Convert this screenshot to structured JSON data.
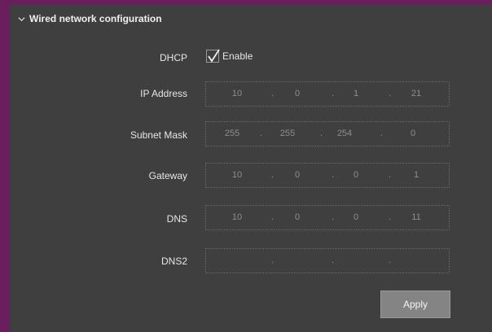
{
  "section": {
    "title": "Wired network configuration"
  },
  "dhcp": {
    "label": "DHCP",
    "checkbox_label": "Enable",
    "checked": true
  },
  "ip_address": {
    "label": "IP Address",
    "octets": [
      "10",
      "0",
      "1",
      "21"
    ]
  },
  "subnet_mask": {
    "label": "Subnet Mask",
    "octets": [
      "255",
      "255",
      "254",
      "0"
    ]
  },
  "gateway": {
    "label": "Gateway",
    "octets": [
      "10",
      "0",
      "0",
      "1"
    ]
  },
  "dns": {
    "label": "DNS",
    "octets": [
      "10",
      "0",
      "0",
      "11"
    ]
  },
  "dns2": {
    "label": "DNS2",
    "octets": [
      "",
      "",
      "",
      ""
    ]
  },
  "apply_button": {
    "label": "Apply"
  },
  "colors": {
    "panel_bg": "#3f3f3f",
    "frame_bg": "#6b1e5c",
    "button_bg": "#848484"
  }
}
